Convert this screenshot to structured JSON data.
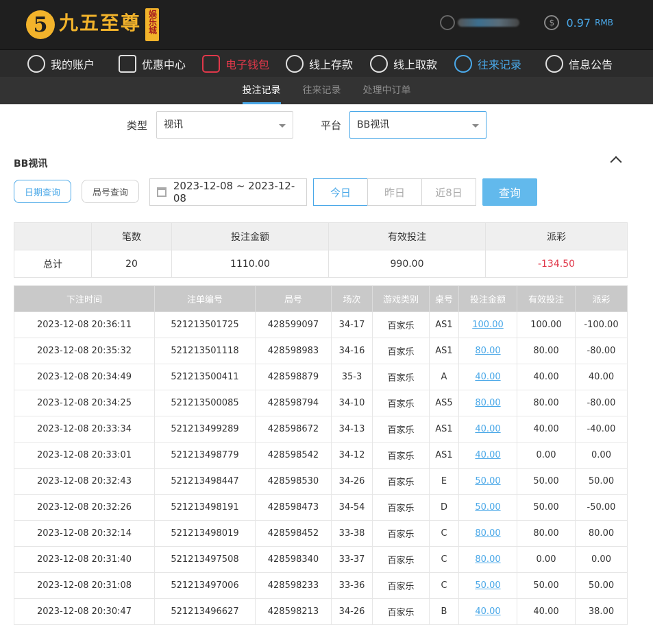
{
  "header": {
    "logo_badge": "5",
    "logo_text": "九五至尊",
    "logo_vertical": "娱乐城",
    "balance": "0.97",
    "currency": "RMB"
  },
  "nav": [
    {
      "label": "我的账户",
      "icon": "user-icon"
    },
    {
      "label": "优惠中心",
      "icon": "gift-icon"
    },
    {
      "label": "电子钱包",
      "icon": "wallet-icon"
    },
    {
      "label": "线上存款",
      "icon": "deposit-icon"
    },
    {
      "label": "线上取款",
      "icon": "withdraw-icon"
    },
    {
      "label": "往来记录",
      "icon": "records-icon"
    },
    {
      "label": "信息公告",
      "icon": "bell-icon"
    }
  ],
  "subnav": [
    "投注记录",
    "往来记录",
    "处理中订单"
  ],
  "filters": {
    "type_label": "类型",
    "type_value": "视讯",
    "platform_label": "平台",
    "platform_value": "BB视讯"
  },
  "section_title": "BB视讯",
  "query": {
    "date_query": "日期查询",
    "round_query": "局号查询",
    "date_range": "2023-12-08 ~ 2023-12-08",
    "today": "今日",
    "yesterday": "昨日",
    "last8": "近8日",
    "search": "查询"
  },
  "summary": {
    "headers": [
      "",
      "笔数",
      "投注金额",
      "有效投注",
      "派彩"
    ],
    "row": [
      "总计",
      "20",
      "1110.00",
      "990.00",
      "-134.50"
    ]
  },
  "detail": {
    "headers": [
      "下注时间",
      "注单编号",
      "局号",
      "场次",
      "游戏类别",
      "桌号",
      "投注金额",
      "有效投注",
      "派彩"
    ],
    "rows": [
      [
        "2023-12-08 20:36:11",
        "521213501725",
        "428599097",
        "34-17",
        "百家乐",
        "AS1",
        "100.00",
        "100.00",
        "-100.00"
      ],
      [
        "2023-12-08 20:35:32",
        "521213501118",
        "428598983",
        "34-16",
        "百家乐",
        "AS1",
        "80.00",
        "80.00",
        "-80.00"
      ],
      [
        "2023-12-08 20:34:49",
        "521213500411",
        "428598879",
        "35-3",
        "百家乐",
        "A",
        "40.00",
        "40.00",
        "40.00"
      ],
      [
        "2023-12-08 20:34:25",
        "521213500085",
        "428598794",
        "34-10",
        "百家乐",
        "AS5",
        "80.00",
        "80.00",
        "-80.00"
      ],
      [
        "2023-12-08 20:33:34",
        "521213499289",
        "428598672",
        "34-13",
        "百家乐",
        "AS1",
        "40.00",
        "40.00",
        "-40.00"
      ],
      [
        "2023-12-08 20:33:01",
        "521213498779",
        "428598542",
        "34-12",
        "百家乐",
        "AS1",
        "40.00",
        "0.00",
        "0.00"
      ],
      [
        "2023-12-08 20:32:43",
        "521213498447",
        "428598530",
        "34-26",
        "百家乐",
        "E",
        "50.00",
        "50.00",
        "50.00"
      ],
      [
        "2023-12-08 20:32:26",
        "521213498191",
        "428598473",
        "34-54",
        "百家乐",
        "D",
        "50.00",
        "50.00",
        "-50.00"
      ],
      [
        "2023-12-08 20:32:14",
        "521213498019",
        "428598452",
        "33-38",
        "百家乐",
        "C",
        "80.00",
        "80.00",
        "80.00"
      ],
      [
        "2023-12-08 20:31:40",
        "521213497508",
        "428598340",
        "33-37",
        "百家乐",
        "C",
        "80.00",
        "0.00",
        "0.00"
      ],
      [
        "2023-12-08 20:31:08",
        "521213497006",
        "428598233",
        "33-36",
        "百家乐",
        "C",
        "50.00",
        "50.00",
        "50.00"
      ],
      [
        "2023-12-08 20:30:47",
        "521213496627",
        "428598213",
        "34-26",
        "百家乐",
        "B",
        "40.00",
        "40.00",
        "38.00"
      ]
    ]
  },
  "colors": {
    "accent": "#4aa8e8",
    "negative": "#e0384a",
    "header_bg": "#1f1f1f",
    "nav_bg": "#2b2b2b"
  }
}
